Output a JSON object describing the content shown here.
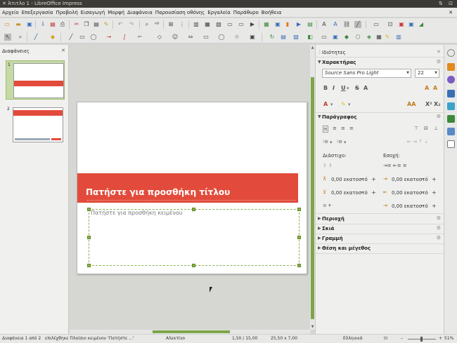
{
  "window": {
    "title": "Άτιτλο 1 - LibreOffice Impress"
  },
  "menu": [
    "Αρχείο",
    "Επεξεργασία",
    "Προβολή",
    "Εισαγωγή",
    "Μορφή",
    "Διαφάνεια",
    "Παρουσίαση οθόνης",
    "Εργαλεία",
    "Παράθυρο",
    "Βοήθεια"
  ],
  "slides_pane": {
    "title": "Διαφάνειες",
    "slides": [
      {
        "number": "1"
      },
      {
        "number": "2"
      }
    ]
  },
  "slide": {
    "title_text": "Πατήστε για προσθήκη τίτλου",
    "body_text": "Πατήστε για προσθήκη κειμένου"
  },
  "sidebar": {
    "title": "Ιδιότητες",
    "character": {
      "title": "Χαρακτήρας",
      "font": "Source Sans Pro Light",
      "size": "22"
    },
    "paragraph": {
      "title": "Παράγραφος",
      "spacing_label": "Διάστιχο:",
      "indent_label": "Εσοχή:",
      "spacing_above": "0,00 εκατοστό",
      "spacing_below": "0,00 εκατοστό",
      "indent_before": "0,00 εκατοστό",
      "indent_after": "0,00 εκατοστό",
      "indent_first": "0,00 εκατοστό"
    },
    "sections": [
      "Περιοχή",
      "Σκιά",
      "Γραμμή",
      "Θέση και μέγεθος"
    ]
  },
  "status": {
    "slide": "Διαφάνεια 1 από 2",
    "selection": "επιλέχθηκε Πλαίσιο κειμένου 'Πατήστε ...'",
    "master": "Αλεκτίνο",
    "position": "1,50 / 15,00",
    "size": "25,50 x 7,00",
    "language": "Ελληνικά",
    "zoom": "51%"
  },
  "colors": {
    "accent_red": "#e24b3b",
    "selection_green": "#7ea649",
    "titlebar": "#3c3b37"
  }
}
